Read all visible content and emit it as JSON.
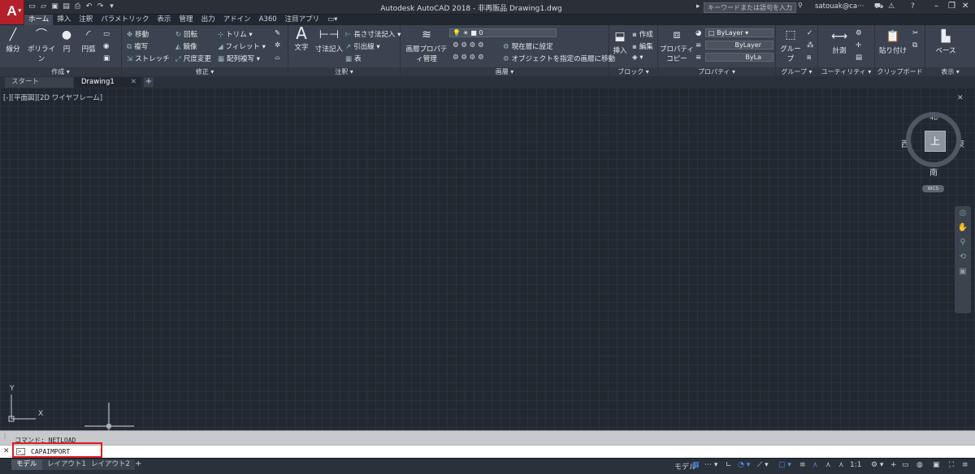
{
  "app": {
    "logo_letter": "A",
    "title": "Autodesk AutoCAD 2018 - 非再販品   Drawing1.dwg",
    "search_placeholder": "キーワードまたは語句を入力",
    "user": "satouak@ca···"
  },
  "ribbon_tabs": [
    "ホーム",
    "挿入",
    "注釈",
    "パラメトリック",
    "表示",
    "管理",
    "出力",
    "アドイン",
    "A360",
    "注目アプリ"
  ],
  "panels": {
    "draw": {
      "title": "作成 ▾",
      "tools": [
        "線分",
        "ポリライン",
        "円",
        "円弧"
      ]
    },
    "modify": {
      "title": "修正 ▾",
      "rows": [
        "移動",
        "回転",
        "トリム ▾",
        "複写",
        "鏡像",
        "フィレット ▾",
        "ストレッチ",
        "尺度変更",
        "配列複写 ▾"
      ]
    },
    "annotation": {
      "title": "注釈 ▾",
      "text": "文字",
      "dimension": "寸法記入",
      "rows": [
        "長さ寸法記入 ▾",
        "引出線 ▾",
        "表"
      ]
    },
    "layers": {
      "title": "画層 ▾",
      "props": "画層プロパティ管理",
      "current_layer": "0",
      "rows": [
        "現在層に設定",
        "オブジェクトを指定の画層に移動"
      ]
    },
    "block": {
      "title": "ブロック ▾",
      "insert": "挿入",
      "rows": [
        "作成",
        "編集"
      ]
    },
    "properties": {
      "title": "プロパティ ▾",
      "match": "プロパティコピー",
      "combos": [
        "ByLayer",
        "ByLayer",
        "ByLa"
      ]
    },
    "groups": {
      "title": "グループ ▾",
      "tool": "グループ"
    },
    "utilities": {
      "title": "ユーティリティ ▾",
      "tool": "計測"
    },
    "clipboard": {
      "title": "クリップボード",
      "tool": "貼り付け"
    },
    "view": {
      "title": "表示 ▾",
      "tool": "ベース"
    }
  },
  "doc_tabs": [
    "スタート",
    "Drawing1"
  ],
  "viewport_label": "[-][平面図][2D ワイヤフレーム]",
  "viewcube": {
    "top": "上",
    "north": "北",
    "south": "南",
    "west": "西",
    "east": "東",
    "wcs": "WCS"
  },
  "ucs": {
    "y": "Y",
    "x": "X"
  },
  "command": {
    "history": "コマンド: NETLOAD",
    "current": "CAPAIMPORT"
  },
  "layouts": [
    "モデル",
    "レイアウト1",
    "レイアウト2"
  ],
  "status": {
    "model": "モデル",
    "scale": "1:1"
  }
}
